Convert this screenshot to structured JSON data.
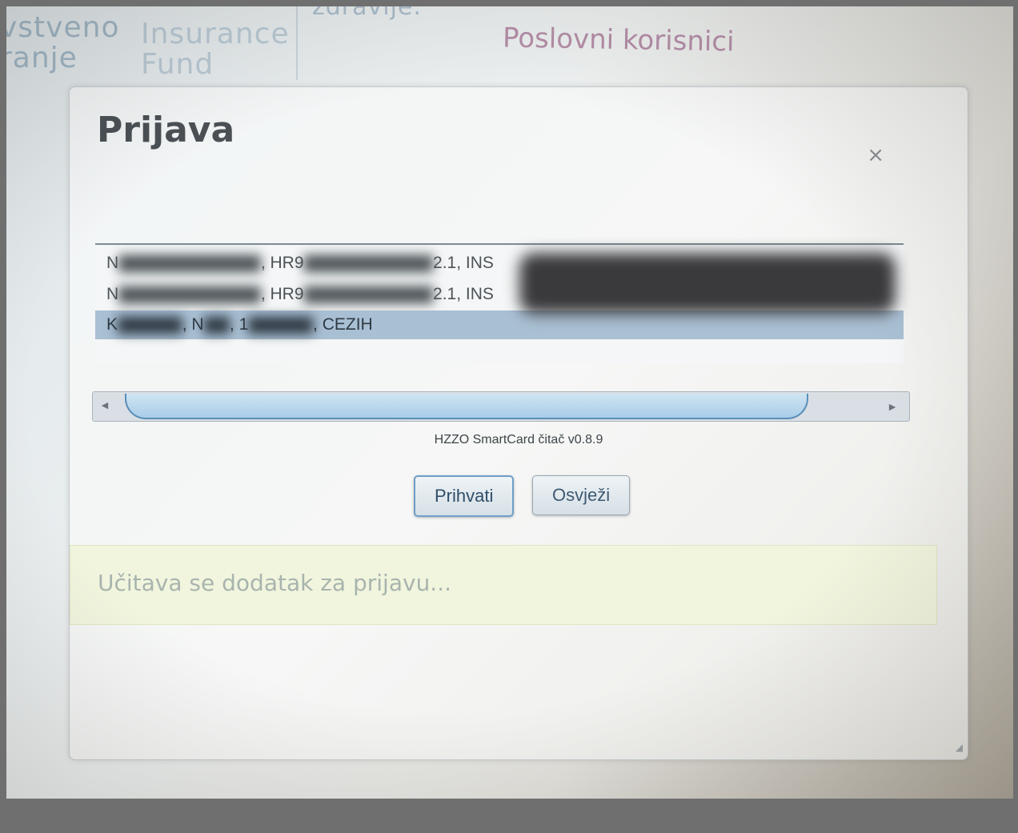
{
  "background": {
    "header_left": [
      "vstveno",
      "ranje"
    ],
    "header_insurance": [
      "Insurance",
      "Fund"
    ],
    "header_zdravlje": "zdravlje.",
    "poslovni": "Poslovni korisnici"
  },
  "dialog": {
    "title": "Prijava",
    "close_glyph": "×",
    "cert_rows": [
      {
        "prefix": "N",
        "mid": ", HR9",
        "suffix": "2.1, INS"
      },
      {
        "prefix": "N",
        "mid": ", HR9",
        "suffix": "2.1, INS"
      },
      {
        "prefix": "K",
        "mid": ", N",
        "mid2": ", 1",
        "suffix": ", CEZIH"
      }
    ],
    "scroll_left_glyph": "◄",
    "scroll_right_glyph": "►",
    "version": "HZZO SmartCard čitač v0.8.9",
    "buttons": {
      "accept": "Prihvati",
      "refresh": "Osvježi"
    },
    "info": "Učitava se dodatak za prijavu...",
    "resize_glyph": "◢"
  },
  "colors": {
    "selected_row": "#a9bfd3",
    "scroll_thumb": "#a9cde8",
    "info_bg": "#f1f5de",
    "title": "#4a5054"
  }
}
